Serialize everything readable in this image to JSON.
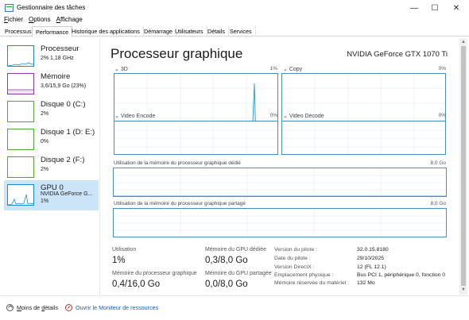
{
  "window": {
    "title": "Gestionnaire des tâches",
    "min_symbol": "—",
    "max_symbol": "☐",
    "close_symbol": "✕"
  },
  "menu": [
    {
      "accel": "F",
      "rest": "ichier"
    },
    {
      "accel": "O",
      "rest": "ptions"
    },
    {
      "accel": "A",
      "rest": "ffichage"
    }
  ],
  "tabs": [
    "Processus",
    "Performance",
    "Historique des applications",
    "Démarrage",
    "Utilisateurs",
    "Détails",
    "Services"
  ],
  "active_tab": "Performance",
  "sidebar": [
    {
      "title": "Processeur",
      "line1": "2% 1,18 GHz",
      "line2": "",
      "color": "#1a8ad4",
      "active": false
    },
    {
      "title": "Mémoire",
      "line1": "3,6/15,9 Go (23%)",
      "line2": "",
      "color": "#8b3aa6",
      "active": false
    },
    {
      "title": "Disque 0 (C:)",
      "line1": "2%",
      "line2": "",
      "color": "#4ea72e",
      "active": false
    },
    {
      "title": "Disque 1 (D: E:)",
      "line1": "0%",
      "line2": "",
      "color": "#4ea72e",
      "active": false
    },
    {
      "title": "Disque 2 (F:)",
      "line1": "2%",
      "line2": "",
      "color": "#4ea72e",
      "active": false
    },
    {
      "title": "GPU 0",
      "line1": "NVIDIA GeForce G...",
      "line2": "1%",
      "color": "#1a8ad4",
      "active": true
    }
  ],
  "main": {
    "title": "Processeur graphique",
    "gpu_name": "NVIDIA GeForce GTX 1070 Ti",
    "engines": [
      {
        "name": "3D",
        "pct": "1%"
      },
      {
        "name": "Copy",
        "pct": "0%"
      },
      {
        "name": "Video Encode",
        "pct": "0%"
      },
      {
        "name": "Video Decode",
        "pct": "0%"
      }
    ],
    "dedicated_label": "Utilisation de la mémoire du processeur graphique dédié",
    "dedicated_max": "8,0 Go",
    "shared_label": "Utilisation de la mémoire du processeur graphique partagé",
    "shared_max": "8,0 Go"
  },
  "stats": {
    "utilisation_label": "Utilisation",
    "utilisation_value": "1%",
    "dedicated_mem_label": "Mémoire du GPU dédiée",
    "dedicated_mem_value": "0,3/8,0 Go",
    "gpu_mem_label": "Mémoire du processeur graphique",
    "gpu_mem_value": "0,4/16,0 Go",
    "shared_mem_label": "Mémoire du GPU partagée",
    "shared_mem_value": "0,0/8,0 Go"
  },
  "info": [
    {
      "label": "Version du pilote :",
      "value": "32.0.15.8180"
    },
    {
      "label": "Date du pilote :",
      "value": "29/10/2025"
    },
    {
      "label": "Version DirectX :",
      "value": "12 (FL 12.1)"
    },
    {
      "label": "Emplacement physique :",
      "value": "Bus PCI 1, périphérique 0, fonction 0"
    },
    {
      "label": "Mémoire réservée du matériel :",
      "value": "132 Mo"
    }
  ],
  "footer": {
    "less_details_accel": "M",
    "less_details_rest": "oins de ",
    "less_details_accel2": "d",
    "less_details_rest2": "étails",
    "resource_monitor": "Ouvrir le Moniteur de ressources"
  }
}
